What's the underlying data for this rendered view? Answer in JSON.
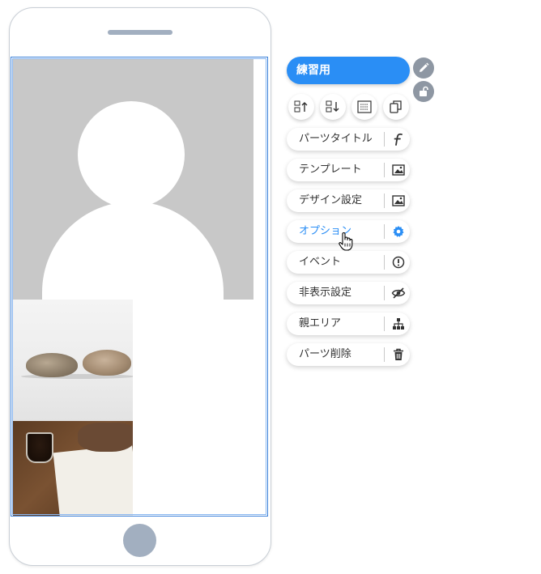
{
  "panel": {
    "title": "練習用",
    "menu": [
      {
        "label": "パーツタイトル",
        "icon": "font-f-icon"
      },
      {
        "label": "テンプレート",
        "icon": "image-icon"
      },
      {
        "label": "デザイン設定",
        "icon": "image-icon"
      },
      {
        "label": "オプション",
        "icon": "gear-icon",
        "active": true
      },
      {
        "label": "イベント",
        "icon": "exclamation-circle-icon"
      },
      {
        "label": "非表示設定",
        "icon": "eye-slash-icon"
      },
      {
        "label": "親エリア",
        "icon": "sitemap-icon"
      },
      {
        "label": "パーツ削除",
        "icon": "trash-icon"
      }
    ],
    "tools": [
      "move-up-icon",
      "move-down-icon",
      "layout-icon",
      "copy-icon"
    ],
    "accent_color": "#2a8ef5"
  }
}
